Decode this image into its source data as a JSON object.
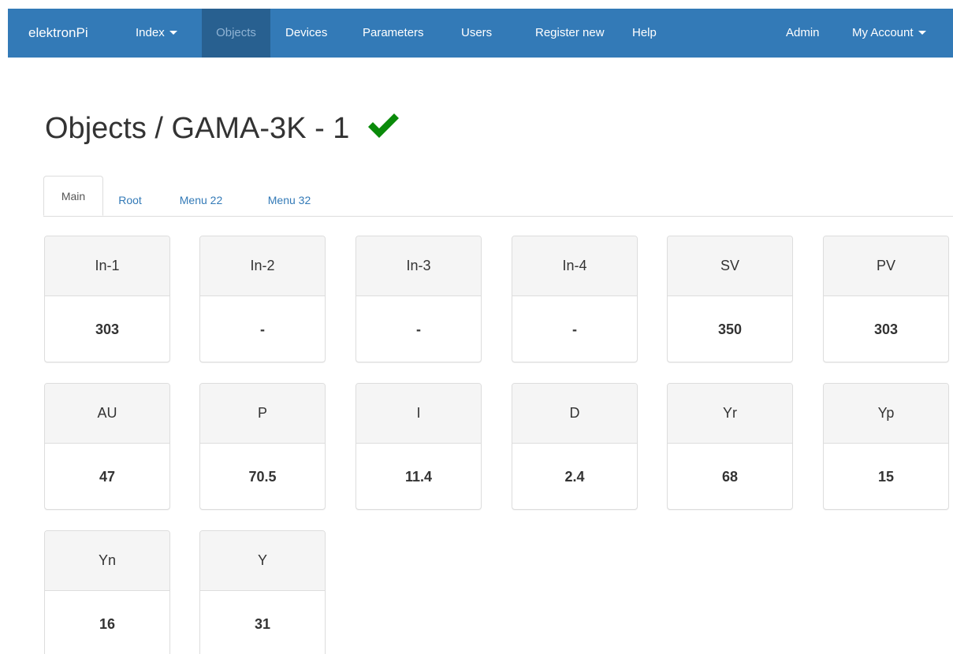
{
  "navbar": {
    "brand": "elektronPi",
    "items": [
      {
        "label": "Index",
        "dropdown": true
      },
      {
        "label": "Objects",
        "active": true
      },
      {
        "label": "Devices"
      },
      {
        "label": "Parameters"
      },
      {
        "label": "Users"
      },
      {
        "label": "Register new"
      },
      {
        "label": "Help"
      }
    ],
    "right": [
      {
        "label": "Admin"
      },
      {
        "label": "My Account",
        "dropdown": true
      }
    ]
  },
  "page": {
    "title": "Objects / GAMA-3K - 1",
    "status_icon": "check-icon",
    "status_color": "#008000"
  },
  "tabs": [
    {
      "label": "Main",
      "active": true
    },
    {
      "label": "Root"
    },
    {
      "label": "Menu 22"
    },
    {
      "label": "Menu 32"
    }
  ],
  "cards": [
    {
      "label": "In-1",
      "value": "303"
    },
    {
      "label": "In-2",
      "value": "-"
    },
    {
      "label": "In-3",
      "value": "-"
    },
    {
      "label": "In-4",
      "value": "-"
    },
    {
      "label": "SV",
      "value": "350"
    },
    {
      "label": "PV",
      "value": "303"
    },
    {
      "label": "AU",
      "value": "47"
    },
    {
      "label": "P",
      "value": "70.5"
    },
    {
      "label": "I",
      "value": "11.4"
    },
    {
      "label": "D",
      "value": "2.4"
    },
    {
      "label": "Yr",
      "value": "68"
    },
    {
      "label": "Yp",
      "value": "15"
    },
    {
      "label": "Yn",
      "value": "16"
    },
    {
      "label": "Y",
      "value": "31"
    }
  ],
  "colors": {
    "navbar": "#337ab7",
    "navbar_active": "#286090",
    "link": "#337ab7"
  }
}
